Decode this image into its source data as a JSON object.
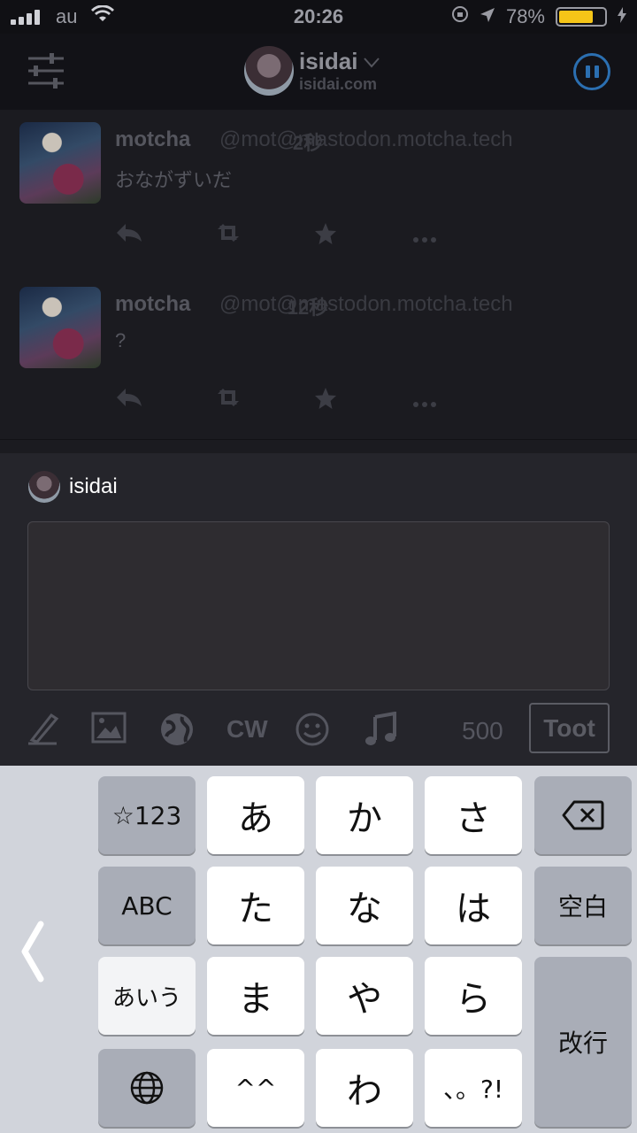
{
  "statusbar": {
    "carrier": "au",
    "time": "20:26",
    "battery_percent": "78%",
    "battery_level": 0.78
  },
  "header": {
    "account_name": "isidai",
    "account_domain": "isidai.com",
    "icons": [
      "tune-icon",
      "chevron-down-icon",
      "pause-icon"
    ],
    "pause_color": "#2b6fb1"
  },
  "timeline": [
    {
      "name": "motcha",
      "handle": "@mot@mastodon.motcha.tech",
      "time": "2秒",
      "content": "おながずいだ"
    },
    {
      "name": "motcha",
      "handle": "@mot@mastodon.motcha.tech",
      "time": "12秒",
      "content": "?"
    }
  ],
  "compose": {
    "account_name": "isidai",
    "toolbar_icons": [
      "pen-icon",
      "image-icon",
      "globe-icon",
      "cw-icon",
      "smile-icon",
      "music-icon"
    ],
    "cw_label": "CW",
    "char_count": "500",
    "toot_label": "Toot"
  },
  "keyboard": {
    "row1": [
      "☆123",
      "あ",
      "か",
      "さ"
    ],
    "row2": [
      "ABC",
      "た",
      "な",
      "は",
      "空白"
    ],
    "row3": [
      "あいう",
      "ま",
      "や",
      "ら",
      "改行"
    ],
    "row4": [
      "^^",
      "わ",
      "、。?!"
    ]
  }
}
